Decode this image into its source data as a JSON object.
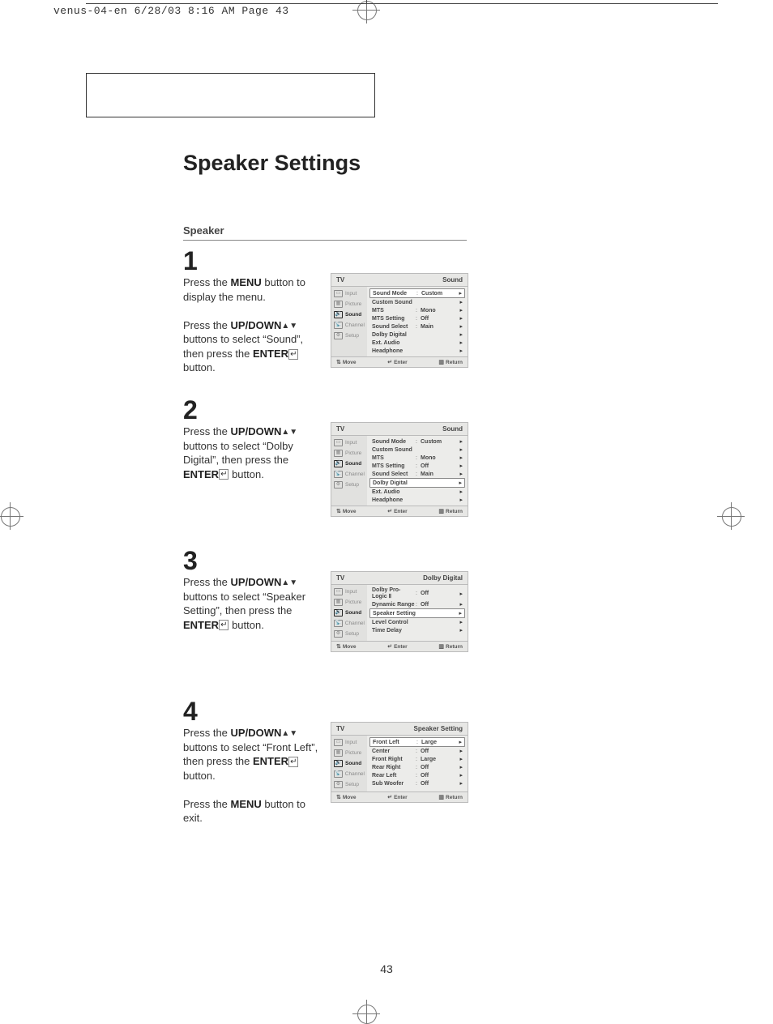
{
  "header": "venus-04-en  6/28/03 8:16 AM  Page 43",
  "page_number": "43",
  "main_title": "Speaker Settings",
  "subheading": "Speaker",
  "footer_labels": {
    "move": "Move",
    "enter": "Enter",
    "return": "Return"
  },
  "osd_header_tv": "TV",
  "tabs": {
    "input": "Input",
    "picture": "Picture",
    "sound": "Sound",
    "channel": "Channel",
    "setup": "Setup"
  },
  "step1": {
    "num": "1",
    "para1a": "Press the ",
    "para1b": "MENU",
    "para1c": " button to display the menu.",
    "para2a": "Press the ",
    "para2b": "UP/DOWN",
    "para2c": " buttons to select “Sound”, then press the ",
    "para2d": "ENTER",
    "para2e": " button.",
    "osd_title_right": "Sound",
    "rows": [
      {
        "label": "Sound Mode",
        "colon": ":",
        "value": "Custom",
        "highlight": true
      },
      {
        "label": "Custom Sound",
        "colon": "",
        "value": ""
      },
      {
        "label": "MTS",
        "colon": ":",
        "value": "Mono"
      },
      {
        "label": "MTS Setting",
        "colon": ":",
        "value": "Off"
      },
      {
        "label": "Sound Select",
        "colon": ":",
        "value": "Main"
      },
      {
        "label": "Dolby Digital",
        "colon": "",
        "value": ""
      },
      {
        "label": "Ext. Audio",
        "colon": "",
        "value": ""
      },
      {
        "label": "Headphone",
        "colon": "",
        "value": ""
      }
    ]
  },
  "step2": {
    "num": "2",
    "para1a": "Press the ",
    "para1b": "UP/DOWN",
    "para1c": " buttons to select “Dolby Digital”, then press the ",
    "para1d": "ENTER",
    "para1e": " button.",
    "osd_title_right": "Sound",
    "rows": [
      {
        "label": "Sound Mode",
        "colon": ":",
        "value": "Custom"
      },
      {
        "label": "Custom Sound",
        "colon": "",
        "value": ""
      },
      {
        "label": "MTS",
        "colon": ":",
        "value": "Mono"
      },
      {
        "label": "MTS Setting",
        "colon": ":",
        "value": "Off"
      },
      {
        "label": "Sound Select",
        "colon": ":",
        "value": "Main"
      },
      {
        "label": "Dolby Digital",
        "colon": "",
        "value": "",
        "highlight": true
      },
      {
        "label": "Ext. Audio",
        "colon": "",
        "value": ""
      },
      {
        "label": "Headphone",
        "colon": "",
        "value": ""
      }
    ]
  },
  "step3": {
    "num": "3",
    "para1a": "Press the ",
    "para1b": "UP/DOWN",
    "para1c": " buttons to select “Speaker Setting”, then press the ",
    "para1d": "ENTER",
    "para1e": " button.",
    "osd_title_right": "Dolby Digital",
    "rows": [
      {
        "label": "Dolby Pro-Logic Ⅱ",
        "colon": ":",
        "value": "Off"
      },
      {
        "label": "Dynamic Range",
        "colon": ":",
        "value": "Off"
      },
      {
        "label": "Speaker Setting",
        "colon": "",
        "value": "",
        "highlight": true
      },
      {
        "label": "Level Control",
        "colon": "",
        "value": ""
      },
      {
        "label": "Time Delay",
        "colon": "",
        "value": ""
      }
    ]
  },
  "step4": {
    "num": "4",
    "para1a": "Press the ",
    "para1b": "UP/DOWN",
    "para1c": " buttons to select “Front Left”, then press the ",
    "para1d": "ENTER",
    "para1e": " button.",
    "para2a": "Press the ",
    "para2b": "MENU",
    "para2c": " button to exit.",
    "osd_title_right": "Speaker Setting",
    "rows": [
      {
        "label": "Front Left",
        "colon": ":",
        "value": "Large",
        "highlight": true
      },
      {
        "label": "Center",
        "colon": ":",
        "value": "Off"
      },
      {
        "label": "Front Right",
        "colon": ":",
        "value": "Large"
      },
      {
        "label": "Rear Right",
        "colon": ":",
        "value": "Off"
      },
      {
        "label": "Rear Left",
        "colon": ":",
        "value": "Off"
      },
      {
        "label": "Sub Woofer",
        "colon": ":",
        "value": "Off"
      }
    ]
  }
}
